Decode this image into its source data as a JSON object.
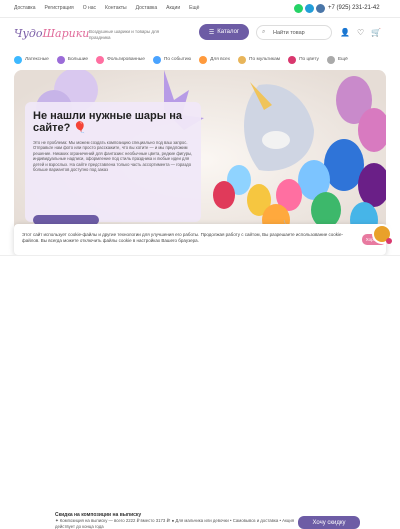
{
  "topnav": [
    "Доставка",
    "Регистрация",
    "О нас",
    "Контакты",
    "Доставка",
    "Акции",
    "Ещё"
  ],
  "phone": "+7 (925) 231-21-42",
  "logo": {
    "left": "Чудо",
    "right": "Шарики"
  },
  "tagline": "Воздушные шарики и товары для праздника",
  "catalog_label": "Каталог",
  "search": {
    "text": "Найти товар"
  },
  "categories": [
    "Латексные",
    "Большие",
    "Фольгированные",
    "По событию",
    "Для всех",
    "По мультикам",
    "По цвету",
    "Ещё"
  ],
  "hero": {
    "title": "Не нашли нужные шары на сайте? 🎈",
    "text": "Это не проблема: Мы можем создать композицию специально под ваш запрос. Отправьте нам фото или просто расскажите, что вы хотите — и мы предложим решение. Никаких ограничений для фантазии: необычные цвета, редкие фигуры, индивидуальные надписи, оформление под стиль праздника и любые идеи для детей и взрослых. На сайте представлена только часть ассортимента — гораздо больше вариантов доступно под заказ"
  },
  "cookie": {
    "text": "Этот сайт использует cookie-файлы и другие технологии для улучшения его работы. Продолжая работу с сайтом, Вы разрешаете использование cookie-файлов. Вы всегда можете отключить файлы cookie в настройках Вашего браузера.",
    "accept": "Хорошо"
  },
  "bundle": {
    "title": "Скидка на композиции на выписку",
    "line1": "✦ Композиция на выписку — всего 2222 ₽ вместо 3173 ₽! ● Для мальчика или девочки • Самовывоз и доставка • Акция действует до конца года"
  },
  "want_button": "Хочу скидку",
  "colors": {
    "accent": "#6d5ca5",
    "pink": "#e87aa0",
    "chat": "#e9a12a"
  }
}
